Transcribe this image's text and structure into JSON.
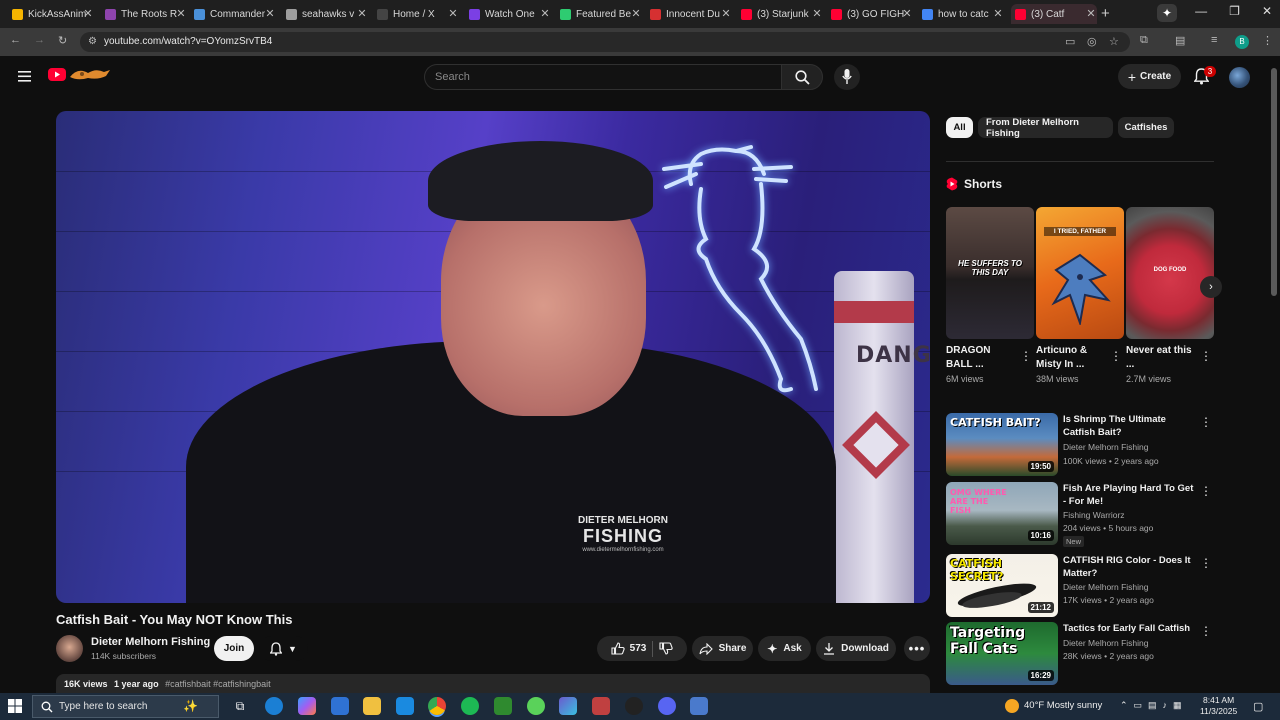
{
  "browser": {
    "tabs": [
      {
        "title": "KickAssAnim",
        "color": "#f5b400"
      },
      {
        "title": "The Roots R",
        "color": "#8e44ad"
      },
      {
        "title": "Commander",
        "color": "#4a90d9"
      },
      {
        "title": "seahawks v",
        "color": "#9e9e9e"
      },
      {
        "title": "Home / X",
        "color": "#444444"
      },
      {
        "title": "Watch One",
        "color": "#7b3fe4"
      },
      {
        "title": "Featured Be",
        "color": "#2ecc71"
      },
      {
        "title": "Innocent Du",
        "color": "#d63031"
      },
      {
        "title": "(3) Starjunk",
        "color": "#ff0033"
      },
      {
        "title": "(3) GO FIGH",
        "color": "#ff0033"
      },
      {
        "title": "how to catc",
        "color": "#4285f4"
      },
      {
        "title": "(3) Catf",
        "color": "#ff0033"
      }
    ],
    "url": "youtube.com/watch?v=OYomzSrvTB4"
  },
  "masthead": {
    "search_placeholder": "Search",
    "create_label": "Create",
    "notifications_count": "3",
    "avatar_letter": "B"
  },
  "video": {
    "title": "Catfish Bait - You May NOT Know This",
    "channel": "Dieter Melhorn Fishing",
    "subscribers": "114K subscribers",
    "join_label": "Join",
    "likes": "573",
    "share_label": "Share",
    "ask_label": "Ask",
    "download_label": "Download",
    "views": "16K views",
    "age": "1 year ago",
    "hashtags": "#catfishbait #catfishingbait",
    "scene_sign_text": "DANG",
    "shirt_logo": {
      "line1": "DIETER MELHORN",
      "line2": "FISHING",
      "line3": "www.dietermelhornfishing.com"
    }
  },
  "sidebar": {
    "chips": [
      {
        "label": "All",
        "active": true
      },
      {
        "label": "From Dieter Melhorn Fishing",
        "active": false
      },
      {
        "label": "Catfishes",
        "active": false
      }
    ],
    "shorts_heading": "Shorts",
    "shorts": [
      {
        "title": "DRAGON BALL ...",
        "views": "6M views",
        "overlay": "HE SUFFERS TO THIS DAY"
      },
      {
        "title": "Articuno & Misty In ...",
        "views": "38M views",
        "overlay": "I TRIED, FATHER"
      },
      {
        "title": "Never eat this ...",
        "views": "2.7M views",
        "overlay": "DOG FOOD"
      }
    ],
    "recommendations": [
      {
        "title": "Is Shrimp The Ultimate Catfish Bait?",
        "channel": "Dieter Melhorn Fishing",
        "meta": "100K views • 2 years ago",
        "duration": "19:50",
        "thumb_text": "CATFISH BAIT?",
        "new": ""
      },
      {
        "title": "Fish Are Playing Hard To Get - For Me!",
        "channel": "Fishing Warriorz",
        "meta": "204 views • 5 hours ago",
        "duration": "10:16",
        "thumb_text": "OMG WHERE ARE THE FISH",
        "new": "New"
      },
      {
        "title": "CATFISH RIG Color - Does It Matter?",
        "channel": "Dieter Melhorn Fishing",
        "meta": "17K views • 2 years ago",
        "duration": "21:12",
        "thumb_text": "CATFISH SECRET?",
        "new": ""
      },
      {
        "title": "Tactics for Early Fall Catfish",
        "channel": "Dieter Melhorn Fishing",
        "meta": "28K views • 2 years ago",
        "duration": "16:29",
        "thumb_text": "Targeting Fall Cats",
        "new": ""
      }
    ]
  },
  "taskbar": {
    "search_placeholder": "Type here to search",
    "weather": "40°F  Mostly sunny",
    "time": "8:41 AM",
    "date": "11/3/2025"
  }
}
